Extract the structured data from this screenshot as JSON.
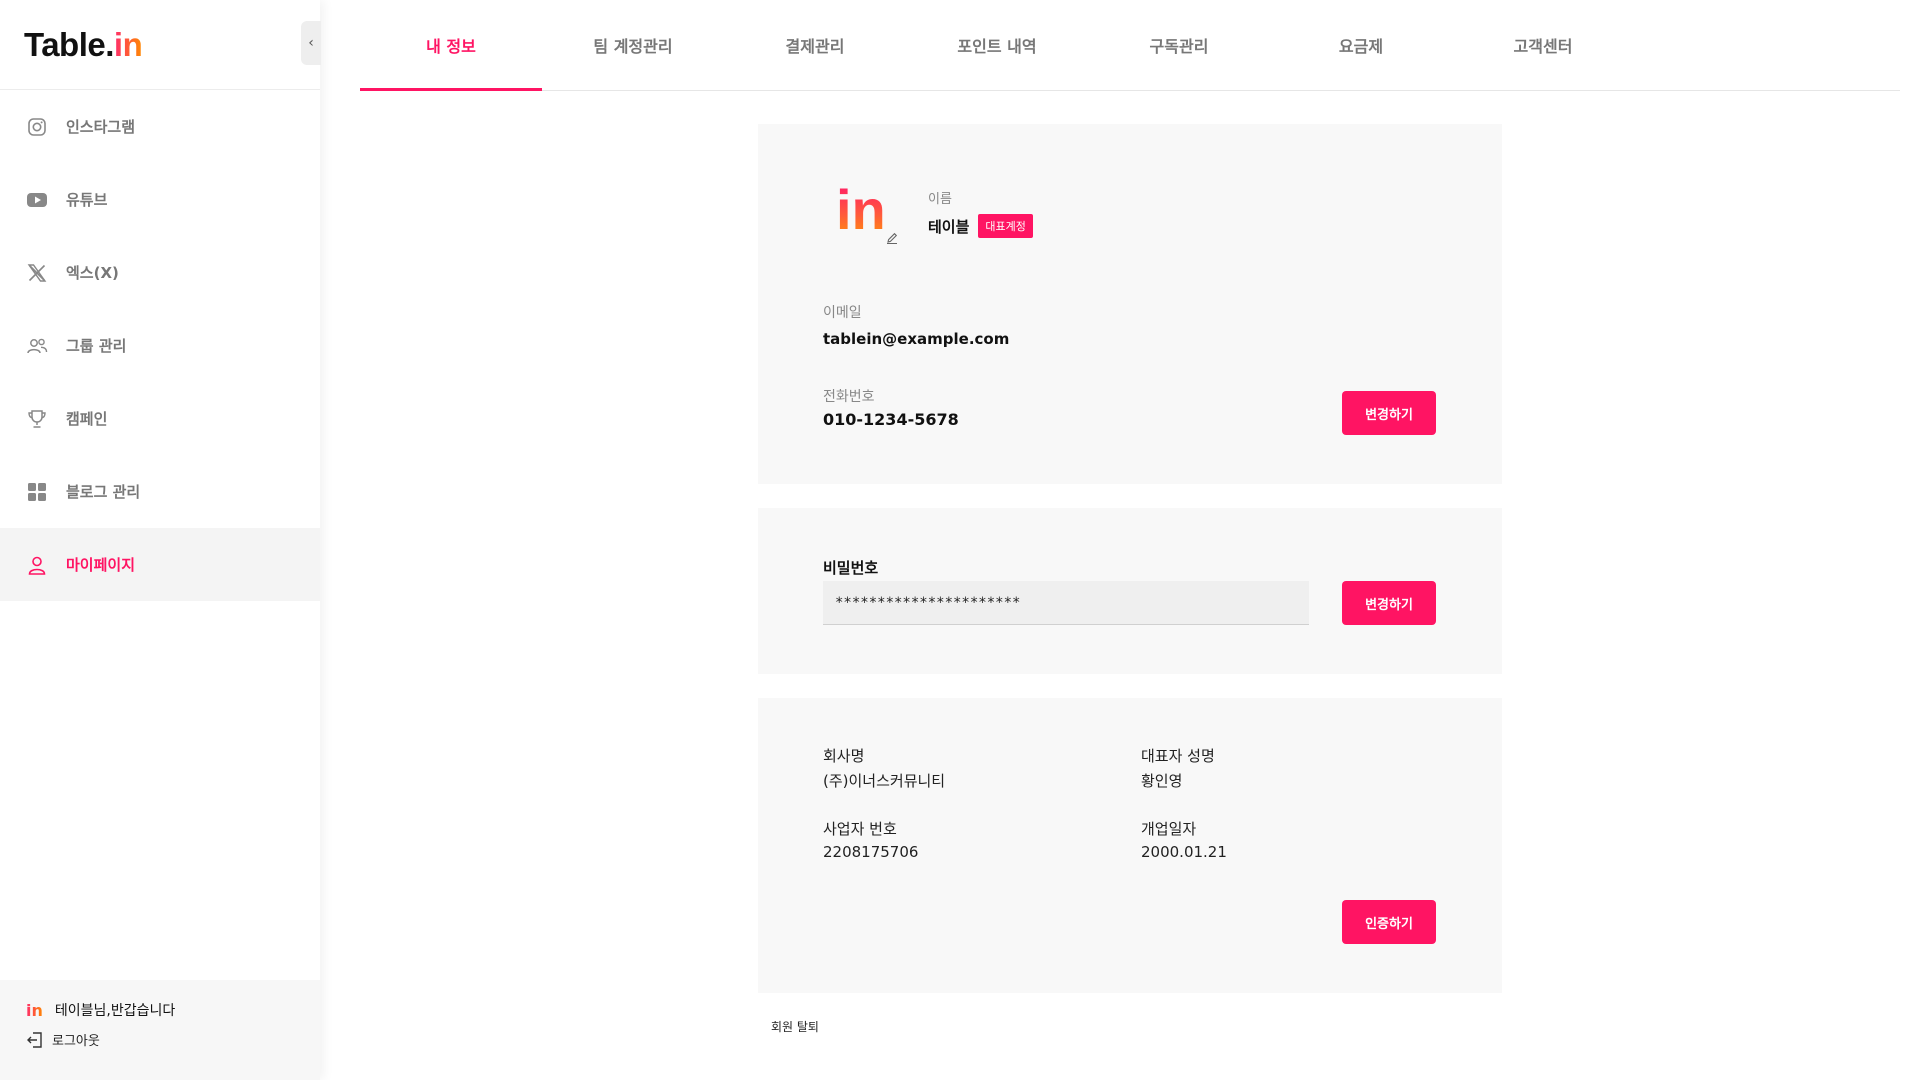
{
  "app": {
    "logo_text": "Table.",
    "logo_accent": "in"
  },
  "sidebar": {
    "collapse_glyph": "‹",
    "items": [
      {
        "label": "인스타그램",
        "icon": "instagram-icon"
      },
      {
        "label": "유튜브",
        "icon": "youtube-icon"
      },
      {
        "label": "엑스(X)",
        "icon": "x-icon"
      },
      {
        "label": "그룹 관리",
        "icon": "group-icon"
      },
      {
        "label": "캠페인",
        "icon": "trophy-icon"
      },
      {
        "label": "블로그 관리",
        "icon": "grid-icon"
      },
      {
        "label": "마이페이지",
        "icon": "user-icon",
        "active": true
      }
    ],
    "footer": {
      "mini_logo": "in",
      "greeting": "테이블님,반갑습니다",
      "logout": "로그아웃"
    }
  },
  "tabs": [
    {
      "label": "내 정보",
      "active": true
    },
    {
      "label": "팀 계정관리"
    },
    {
      "label": "결제관리"
    },
    {
      "label": "포인트 내역"
    },
    {
      "label": "구독관리"
    },
    {
      "label": "요금제"
    },
    {
      "label": "고객센터"
    }
  ],
  "profile": {
    "logo_text": "in",
    "name_label": "이름",
    "name": "테이블",
    "badge": "대표계정",
    "email_label": "이메일",
    "email": "tablein@example.com",
    "phone_label": "전화번호",
    "phone": "010-1234-5678",
    "change_button": "변경하기"
  },
  "password": {
    "label": "비밀번호",
    "value": "**********************",
    "change_button": "변경하기"
  },
  "company": {
    "company_name_label": "회사명",
    "company_name": "(주)이너스커뮤니티",
    "ceo_label": "대표자 성명",
    "ceo": "황인영",
    "biz_no_label": "사업자 번호",
    "biz_no": "2208175706",
    "open_date_label": "개업일자",
    "open_date": "2000.01.21",
    "verify_button": "인증하기"
  },
  "withdraw": "회원 탈퇴",
  "colors": {
    "accent": "#ff1463",
    "gradient_end": "#ff8a00"
  }
}
